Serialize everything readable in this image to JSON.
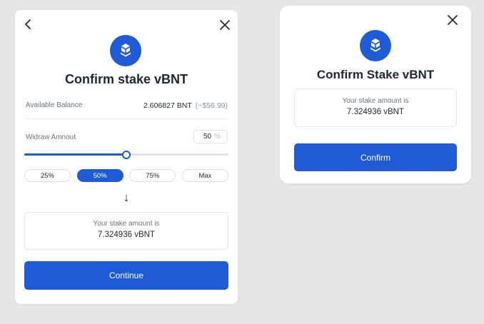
{
  "left_modal": {
    "title": "Confirm stake vBNT",
    "balance": {
      "label": "Available Balance",
      "value": "2.606827 BNT",
      "usd": "(~$56.99)"
    },
    "withdraw": {
      "label": "Widraw Amnout",
      "value": "50",
      "symbol": "%",
      "slider_fraction": 0.5
    },
    "chips": [
      "25%",
      "50%",
      "75%",
      "Max"
    ],
    "active_chip": "50%",
    "arrow": "↓",
    "stake": {
      "label": "Your stake amount is",
      "amount": "7.324936 vBNT"
    },
    "button_label": "Continue"
  },
  "right_modal": {
    "title": "Confirm Stake vBNT",
    "stake": {
      "label": "Your stake amount is",
      "amount": "7.324936 vBNT"
    },
    "button_label": "Confirm"
  },
  "colors": {
    "accent": "#1f5bd6",
    "background": "#e6e6e6",
    "card": "#ffffff"
  },
  "icons": [
    "back-chevron-icon",
    "close-icon",
    "bancor-logo-icon"
  ]
}
